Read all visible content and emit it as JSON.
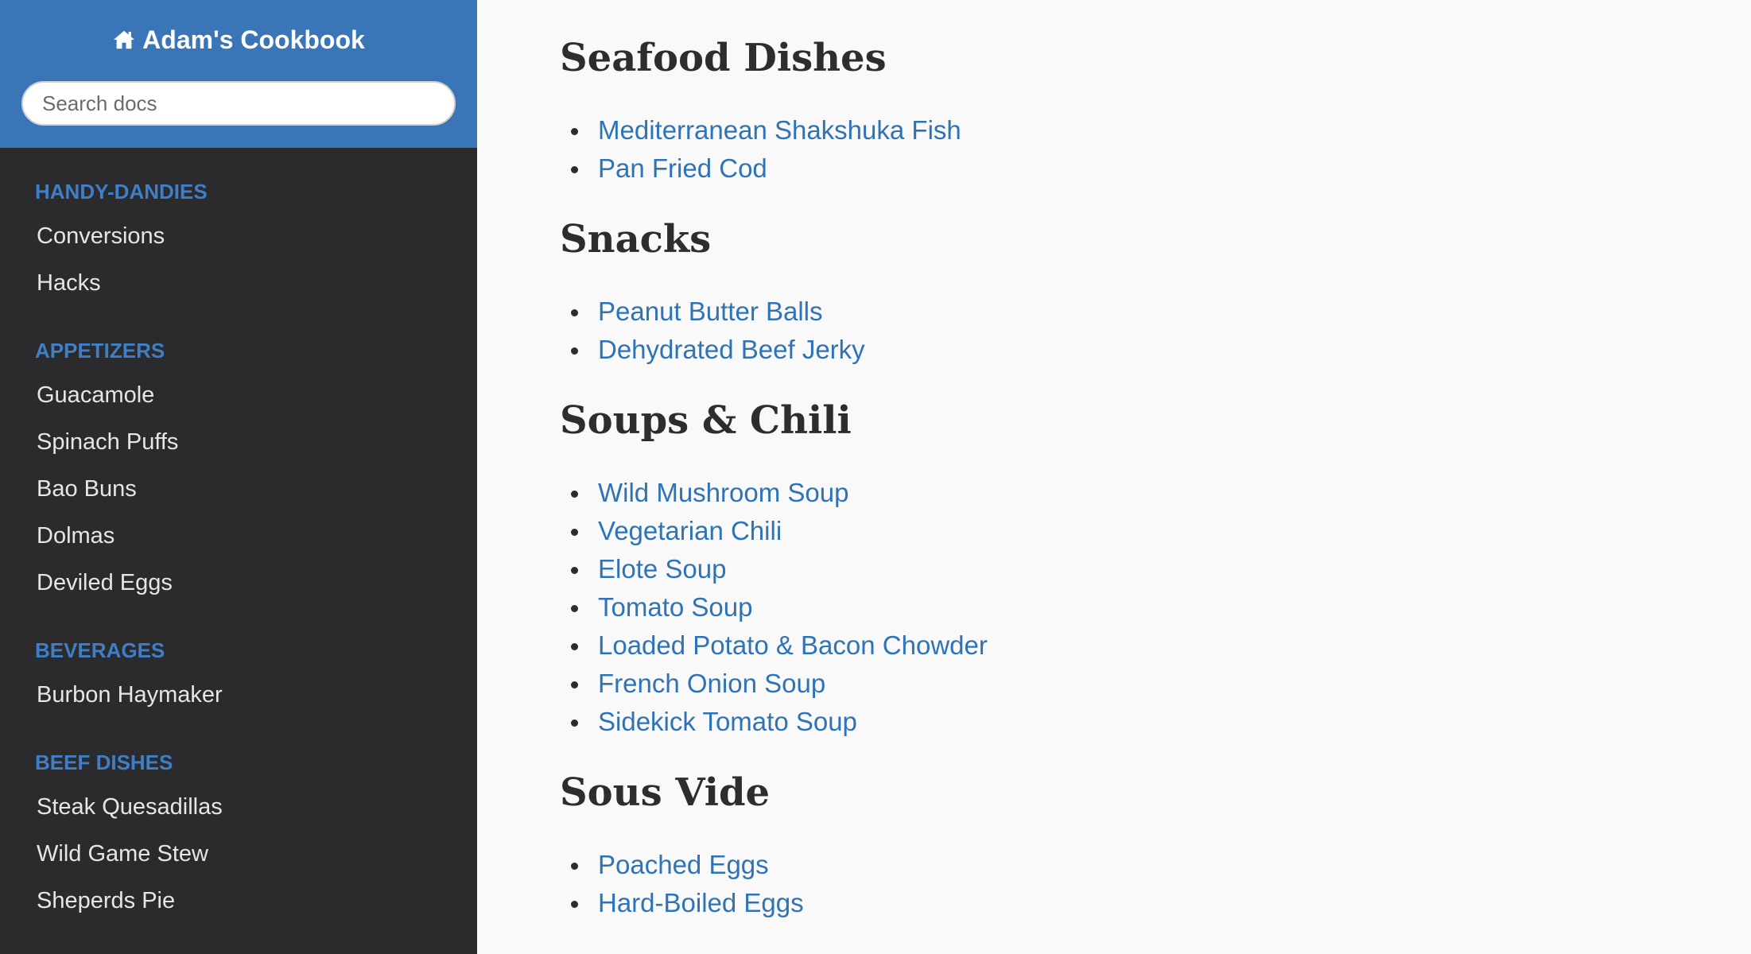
{
  "sidebar": {
    "brand": "Adam's Cookbook",
    "search_placeholder": "Search docs",
    "sections": [
      {
        "caption": "HANDY-DANDIES",
        "items": [
          "Conversions",
          "Hacks"
        ]
      },
      {
        "caption": "APPETIZERS",
        "items": [
          "Guacamole",
          "Spinach Puffs",
          "Bao Buns",
          "Dolmas",
          "Deviled Eggs"
        ]
      },
      {
        "caption": "BEVERAGES",
        "items": [
          "Burbon Haymaker"
        ]
      },
      {
        "caption": "BEEF DISHES",
        "items": [
          "Steak Quesadillas",
          "Wild Game Stew",
          "Sheperds Pie"
        ]
      }
    ]
  },
  "main": {
    "sections": [
      {
        "heading": "Seafood Dishes",
        "links": [
          "Mediterranean Shakshuka Fish",
          "Pan Fried Cod"
        ]
      },
      {
        "heading": "Snacks",
        "links": [
          "Peanut Butter Balls",
          "Dehydrated Beef Jerky"
        ]
      },
      {
        "heading": "Soups & Chili",
        "links": [
          "Wild Mushroom Soup",
          "Vegetarian Chili",
          "Elote Soup",
          "Tomato Soup",
          "Loaded Potato & Bacon Chowder",
          "French Onion Soup",
          "Sidekick Tomato Soup"
        ]
      },
      {
        "heading": "Sous Vide",
        "links": [
          "Poached Eggs",
          "Hard-Boiled Eggs"
        ]
      }
    ]
  },
  "colors": {
    "sidebar_header": "#3a75b8",
    "sidebar_bg": "#2b2a2c",
    "caption": "#3f7fc8",
    "link": "#2f73b7"
  },
  "icons": {
    "brand": "home-icon"
  }
}
